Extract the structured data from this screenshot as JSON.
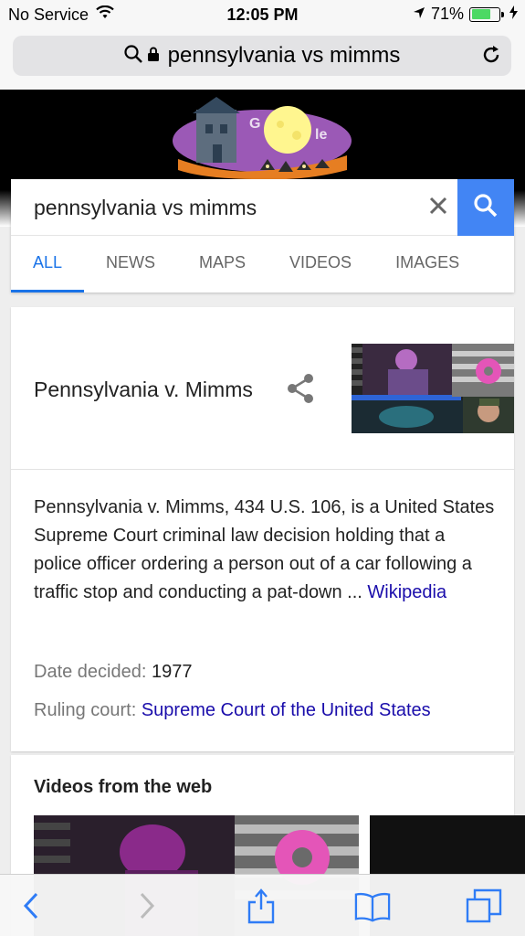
{
  "status_bar": {
    "carrier": "No Service",
    "time": "12:05 PM",
    "battery": "71%",
    "battery_level": 0.71
  },
  "address_bar": {
    "url_text": "pennsylvania vs mimms"
  },
  "search": {
    "query": "pennsylvania vs mimms",
    "tabs": [
      "ALL",
      "NEWS",
      "MAPS",
      "VIDEOS",
      "IMAGES"
    ],
    "active_tab": "ALL"
  },
  "knowledge_panel": {
    "title": "Pennsylvania v. Mimms",
    "description": "Pennsylvania v. Mimms, 434 U.S. 106, is a United States Supreme Court criminal law decision holding that a police officer ordering a person out of a car following a traffic stop and conducting a pat-down ...",
    "source_link": "Wikipedia",
    "facts": [
      {
        "label": "Date decided:",
        "value": "1977"
      },
      {
        "label": "Ruling court:",
        "value": "Supreme Court of the United States"
      }
    ]
  },
  "videos": {
    "heading": "Videos from the web"
  },
  "colors": {
    "accent": "#4285f4",
    "link": "#1a0dab",
    "ios_blue": "#2f7cf6"
  },
  "icons": [
    "wifi-icon",
    "location-arrow-icon",
    "battery-icon",
    "charging-icon",
    "magnifier-icon",
    "lock-icon",
    "reload-icon",
    "google-doodle",
    "close-icon",
    "search-icon",
    "share-icon",
    "back-icon",
    "forward-icon",
    "share-sheet-icon",
    "bookmarks-icon",
    "tabs-icon"
  ]
}
